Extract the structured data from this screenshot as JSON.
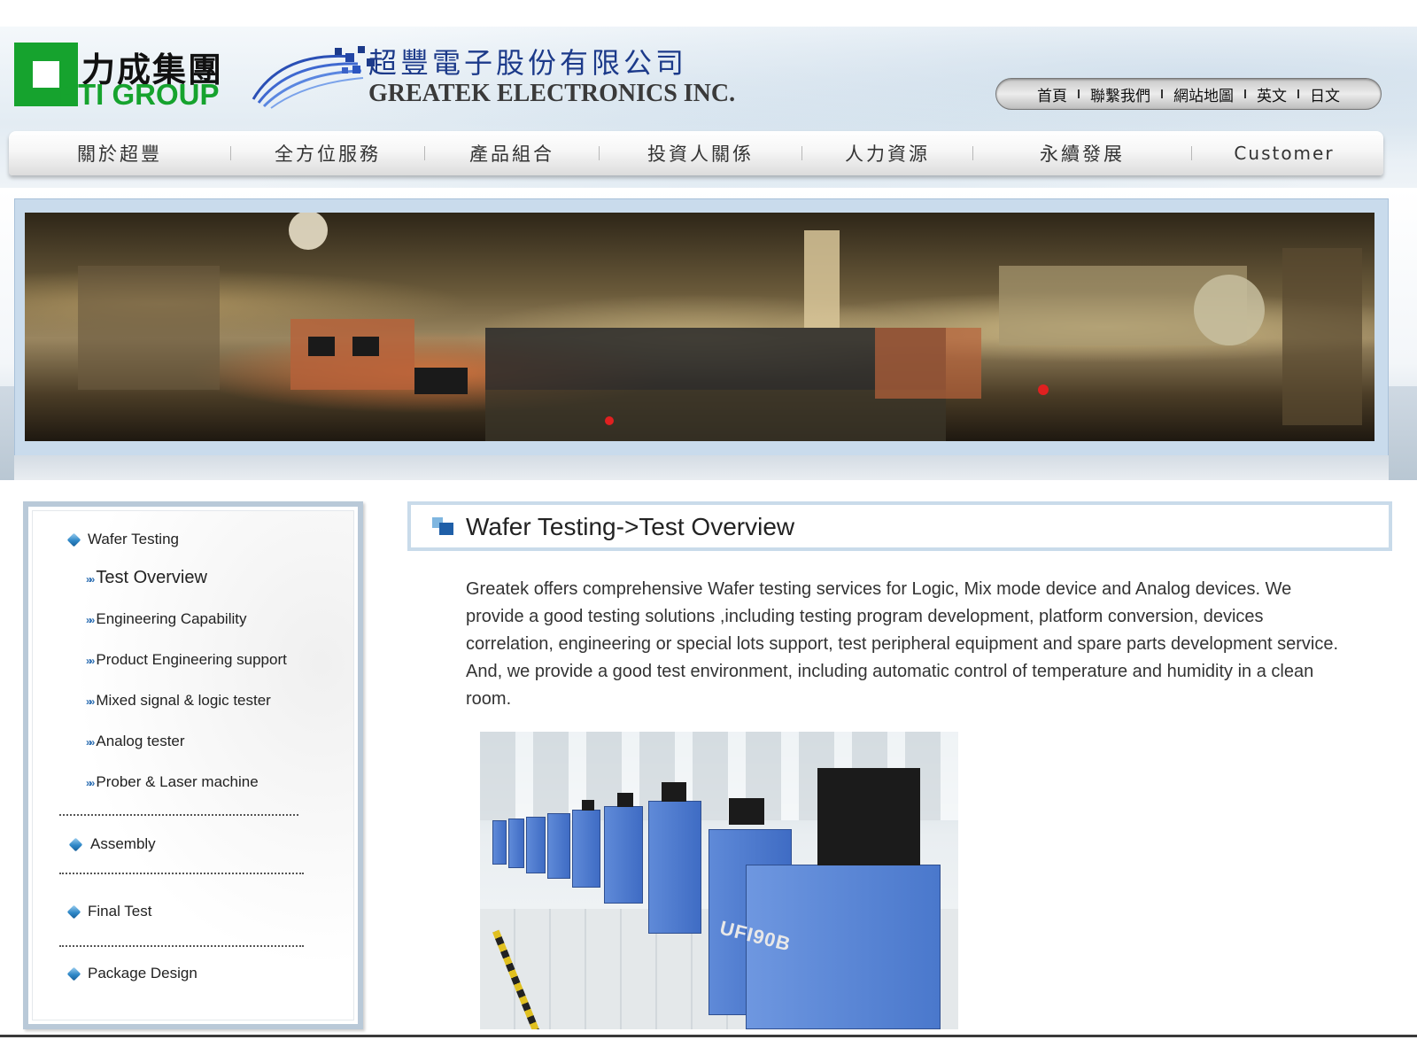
{
  "header": {
    "pti_logo_zh": "力成集團",
    "pti_logo_en": "PTI GROUP",
    "company_zh": "超豐電子股份有限公司",
    "company_en": "GREATEK ELECTRONICS INC.",
    "top_links": [
      "首頁",
      "聯繫我們",
      "網站地圖",
      "英文",
      "日文"
    ]
  },
  "nav": {
    "items": [
      "關於超豐",
      "全方位服務",
      "產品組合",
      "投資人關係",
      "人力資源",
      "永續發展",
      "Customer"
    ]
  },
  "sidebar": {
    "categories": [
      {
        "label": "Wafer Testing",
        "children": [
          "Test Overview",
          "Engineering Capability",
          "Product Engineering support",
          "Mixed signal & logic tester",
          "Analog tester",
          "Prober & Laser machine"
        ]
      },
      {
        "label": "Assembly"
      },
      {
        "label": "Final Test"
      },
      {
        "label": "Package Design"
      }
    ]
  },
  "content": {
    "title": "Wafer Testing->Test Overview",
    "paragraph": "Greatek offers comprehensive Wafer testing services for Logic, Mix mode device and Analog devices. We provide a good testing solutions ,including testing program development, platform conversion, devices correlation, engineering or special lots support, test peripheral equipment and spare parts development service. And, we provide a good test environment, including automatic control of temperature and humidity in a clean room.",
    "photo_machine_label": "UFI90B"
  },
  "colors": {
    "pti_green": "#16a32e",
    "greatek_blue": "#1c3a8a",
    "frame_blue": "#c9dbea",
    "icon_blue": "#2f88c8"
  },
  "icons": {
    "category_bullet": "blue-cube-icon",
    "sub_bullet": "double-chevron-icon",
    "title_icon": "blue-squares-icon"
  }
}
